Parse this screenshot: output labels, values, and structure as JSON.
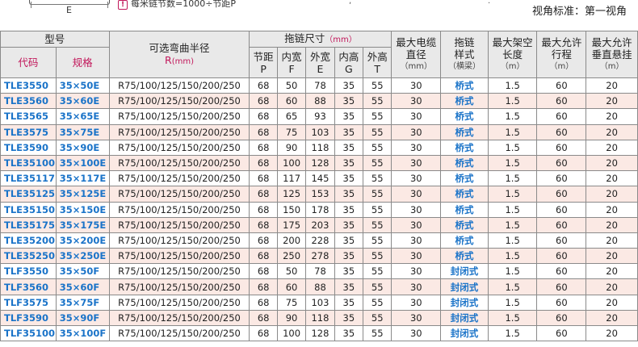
{
  "top": {
    "diagram_label": "E",
    "note_icon": "!",
    "note_text": "每米链节数=1000÷节距P",
    "view_standard": "视角标准：第一视角"
  },
  "header": {
    "model": "型号",
    "code": "代码",
    "spec": "规格",
    "radius_title": "可选弯曲半径",
    "radius_symbol": "R",
    "radius_unit": "(mm)",
    "chain_size": "拖链尺寸",
    "chain_size_unit": "（mm）",
    "pitch": "节距",
    "pitch_sym": "P",
    "inner_width": "内宽",
    "inner_width_sym": "F",
    "outer_width": "外宽",
    "outer_width_sym": "E",
    "inner_height": "内高",
    "inner_height_sym": "G",
    "outer_height": "外高",
    "outer_height_sym": "T",
    "max_cable_1": "最大电缆",
    "max_cable_2": "直径",
    "max_cable_unit": "（mm）",
    "chain_style_1": "拖链",
    "chain_style_2": "样式",
    "chain_style_sub": "（横梁）",
    "max_span_1": "最大架空",
    "max_span_2": "长度",
    "max_span_unit": "（m）",
    "max_travel_1": "最大允许",
    "max_travel_2": "行程",
    "max_travel_unit": "（m）",
    "max_hang_1": "最大允许",
    "max_hang_2": "垂直悬挂",
    "max_hang_unit": "（m）"
  },
  "rows": [
    {
      "code": "TLE3550",
      "spec": "35×50E",
      "radius": "R75/100/125/150/200/250",
      "p": "68",
      "f": "50",
      "e": "78",
      "g": "35",
      "t": "55",
      "cable": "30",
      "style": "桥式",
      "span": "1.5",
      "travel": "60",
      "hang": "20"
    },
    {
      "code": "TLE3560",
      "spec": "35×60E",
      "radius": "R75/100/125/150/200/250",
      "p": "68",
      "f": "60",
      "e": "88",
      "g": "35",
      "t": "55",
      "cable": "30",
      "style": "桥式",
      "span": "1.5",
      "travel": "60",
      "hang": "20"
    },
    {
      "code": "TLE3565",
      "spec": "35×65E",
      "radius": "R75/100/125/150/200/250",
      "p": "68",
      "f": "65",
      "e": "93",
      "g": "35",
      "t": "55",
      "cable": "30",
      "style": "桥式",
      "span": "1.5",
      "travel": "60",
      "hang": "20"
    },
    {
      "code": "TLE3575",
      "spec": "35×75E",
      "radius": "R75/100/125/150/200/250",
      "p": "68",
      "f": "75",
      "e": "103",
      "g": "35",
      "t": "55",
      "cable": "30",
      "style": "桥式",
      "span": "1.5",
      "travel": "60",
      "hang": "20"
    },
    {
      "code": "TLE3590",
      "spec": "35×90E",
      "radius": "R75/100/125/150/200/250",
      "p": "68",
      "f": "90",
      "e": "118",
      "g": "35",
      "t": "55",
      "cable": "30",
      "style": "桥式",
      "span": "1.5",
      "travel": "60",
      "hang": "20"
    },
    {
      "code": "TLE35100",
      "spec": "35×100E",
      "radius": "R75/100/125/150/200/250",
      "p": "68",
      "f": "100",
      "e": "128",
      "g": "35",
      "t": "55",
      "cable": "30",
      "style": "桥式",
      "span": "1.5",
      "travel": "60",
      "hang": "20"
    },
    {
      "code": "TLE35117",
      "spec": "35×117E",
      "radius": "R75/100/125/150/200/250",
      "p": "68",
      "f": "117",
      "e": "145",
      "g": "35",
      "t": "55",
      "cable": "30",
      "style": "桥式",
      "span": "1.5",
      "travel": "60",
      "hang": "20"
    },
    {
      "code": "TLE35125",
      "spec": "35×125E",
      "radius": "R75/100/125/150/200/250",
      "p": "68",
      "f": "125",
      "e": "153",
      "g": "35",
      "t": "55",
      "cable": "30",
      "style": "桥式",
      "span": "1.5",
      "travel": "60",
      "hang": "20"
    },
    {
      "code": "TLE35150",
      "spec": "35×150E",
      "radius": "R75/100/125/150/200/250",
      "p": "68",
      "f": "150",
      "e": "178",
      "g": "35",
      "t": "55",
      "cable": "30",
      "style": "桥式",
      "span": "1.5",
      "travel": "60",
      "hang": "20"
    },
    {
      "code": "TLE35175",
      "spec": "35×175E",
      "radius": "R75/100/125/150/200/250",
      "p": "68",
      "f": "175",
      "e": "203",
      "g": "35",
      "t": "55",
      "cable": "30",
      "style": "桥式",
      "span": "1.5",
      "travel": "60",
      "hang": "20"
    },
    {
      "code": "TLE35200",
      "spec": "35×200E",
      "radius": "R75/100/125/150/200/250",
      "p": "68",
      "f": "200",
      "e": "228",
      "g": "35",
      "t": "55",
      "cable": "30",
      "style": "桥式",
      "span": "1.5",
      "travel": "60",
      "hang": "20"
    },
    {
      "code": "TLE35250",
      "spec": "35×250E",
      "radius": "R75/100/125/150/200/250",
      "p": "68",
      "f": "250",
      "e": "278",
      "g": "35",
      "t": "55",
      "cable": "30",
      "style": "桥式",
      "span": "1.5",
      "travel": "60",
      "hang": "20"
    },
    {
      "code": "TLF3550",
      "spec": "35×50F",
      "radius": "R75/100/125/150/200/250",
      "p": "68",
      "f": "50",
      "e": "78",
      "g": "35",
      "t": "55",
      "cable": "30",
      "style": "封闭式",
      "span": "1.5",
      "travel": "60",
      "hang": "20"
    },
    {
      "code": "TLF3560",
      "spec": "35×60F",
      "radius": "R75/100/125/150/200/250",
      "p": "68",
      "f": "60",
      "e": "88",
      "g": "35",
      "t": "55",
      "cable": "30",
      "style": "封闭式",
      "span": "1.5",
      "travel": "60",
      "hang": "20"
    },
    {
      "code": "TLF3575",
      "spec": "35×75F",
      "radius": "R75/100/125/150/200/250",
      "p": "68",
      "f": "75",
      "e": "103",
      "g": "35",
      "t": "55",
      "cable": "30",
      "style": "封闭式",
      "span": "1.5",
      "travel": "60",
      "hang": "20"
    },
    {
      "code": "TLF3590",
      "spec": "35×90F",
      "radius": "R75/100/125/150/200/250",
      "p": "68",
      "f": "90",
      "e": "118",
      "g": "35",
      "t": "55",
      "cable": "30",
      "style": "封闭式",
      "span": "1.5",
      "travel": "60",
      "hang": "20"
    },
    {
      "code": "TLF35100",
      "spec": "35×100F",
      "radius": "R75/100/125/150/200/250",
      "p": "68",
      "f": "100",
      "e": "128",
      "g": "35",
      "t": "55",
      "cable": "30",
      "style": "封闭式",
      "span": "1.5",
      "travel": "60",
      "hang": "20"
    }
  ]
}
